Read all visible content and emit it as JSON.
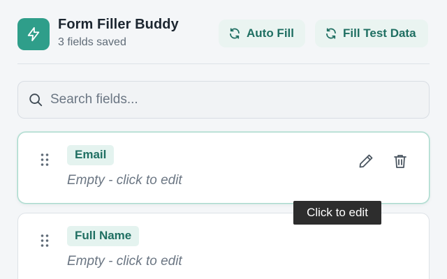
{
  "header": {
    "title": "Form Filler Buddy",
    "subtitle": "3 fields saved",
    "logo_icon": "lightning-icon",
    "auto_fill_label": "Auto Fill",
    "fill_test_label": "Fill Test Data",
    "action_icon": "refresh-icon"
  },
  "search": {
    "placeholder": "Search fields..."
  },
  "fields": [
    {
      "label": "Email",
      "value": "Empty - click to edit"
    },
    {
      "label": "Full Name",
      "value": "Empty - click to edit"
    }
  ],
  "tooltip": "Click to edit",
  "colors": {
    "accent": "#2f9e8a",
    "accent_text": "#1f6f62",
    "badge_bg": "#e4f3ef",
    "background": "#f4f6f8"
  }
}
